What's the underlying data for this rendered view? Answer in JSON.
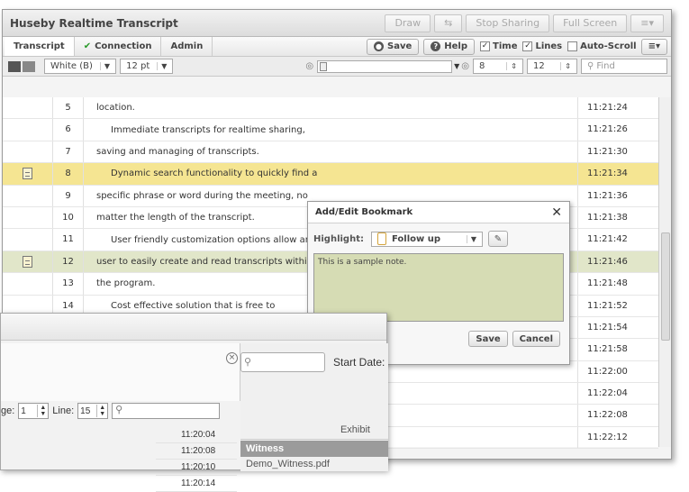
{
  "window": {
    "title": "Huseby Realtime Transcript",
    "buttons": {
      "draw": "Draw",
      "stop_sharing": "Stop Sharing",
      "full_screen": "Full Screen"
    }
  },
  "tabs": [
    {
      "label": "Transcript"
    },
    {
      "label": "Connection"
    },
    {
      "label": "Admin"
    }
  ],
  "actions": {
    "save": "Save",
    "help": "Help"
  },
  "options": {
    "time": "Time",
    "lines": "Lines",
    "auto_scroll": "Auto-Scroll"
  },
  "toolbar": {
    "color": "White (B)",
    "font_size": "12 pt",
    "from_line": "8",
    "to_line": "12",
    "find_placeholder": "Find"
  },
  "rows": [
    {
      "line": "5",
      "text": "location.",
      "time": "11:21:24"
    },
    {
      "line": "6",
      "text": "Immediate transcripts for realtime sharing,",
      "time": "11:21:26"
    },
    {
      "line": "7",
      "text": "saving and managing of transcripts.",
      "time": "11:21:30"
    },
    {
      "line": "8",
      "text": "Dynamic search functionality to quickly find a",
      "time": "11:21:34"
    },
    {
      "line": "9",
      "text": "specific phrase or word during the meeting, no",
      "time": "11:21:36"
    },
    {
      "line": "10",
      "text": "matter the length of the transcript.",
      "time": "11:21:38"
    },
    {
      "line": "11",
      "text": "User friendly customization options allow any",
      "time": "11:21:42"
    },
    {
      "line": "12",
      "text": "user to easily create and read transcripts within",
      "time": "11:21:46"
    },
    {
      "line": "13",
      "text": "the program.",
      "time": "11:21:48"
    },
    {
      "line": "14",
      "text": "Cost effective solution that is free to",
      "time": "11:21:52"
    },
    {
      "line": "",
      "text": "",
      "time": "11:21:54"
    },
    {
      "line": "",
      "text": "",
      "time": "11:21:58"
    },
    {
      "line": "",
      "text": "",
      "time": "11:22:00"
    },
    {
      "line": "",
      "text": "",
      "time": "11:22:04"
    },
    {
      "line": "",
      "text": "",
      "time": "11:22:08"
    },
    {
      "line": "",
      "text": "",
      "time": "11:22:12"
    }
  ],
  "bookmark_dialog": {
    "title": "Add/Edit Bookmark",
    "highlight_label": "Highlight:",
    "highlight_value": "Follow up",
    "note": "This is a sample note.",
    "save": "Save",
    "cancel": "Cancel",
    "colors": {
      "yellow": "#f5e592",
      "green": "#e1e6c9",
      "note_bg": "#d6dcb4"
    }
  },
  "background_window": {
    "page_label": "ge:",
    "page_value": "1",
    "line_label": "Line:",
    "line_value": "15",
    "start_date_label": "Start Date:",
    "exhibit_label": "Exhibit",
    "witness_label": "Witness",
    "file_name": "Demo_Witness.pdf",
    "times": [
      "11:20:04",
      "11:20:08",
      "11:20:10",
      "11:20:14"
    ]
  }
}
